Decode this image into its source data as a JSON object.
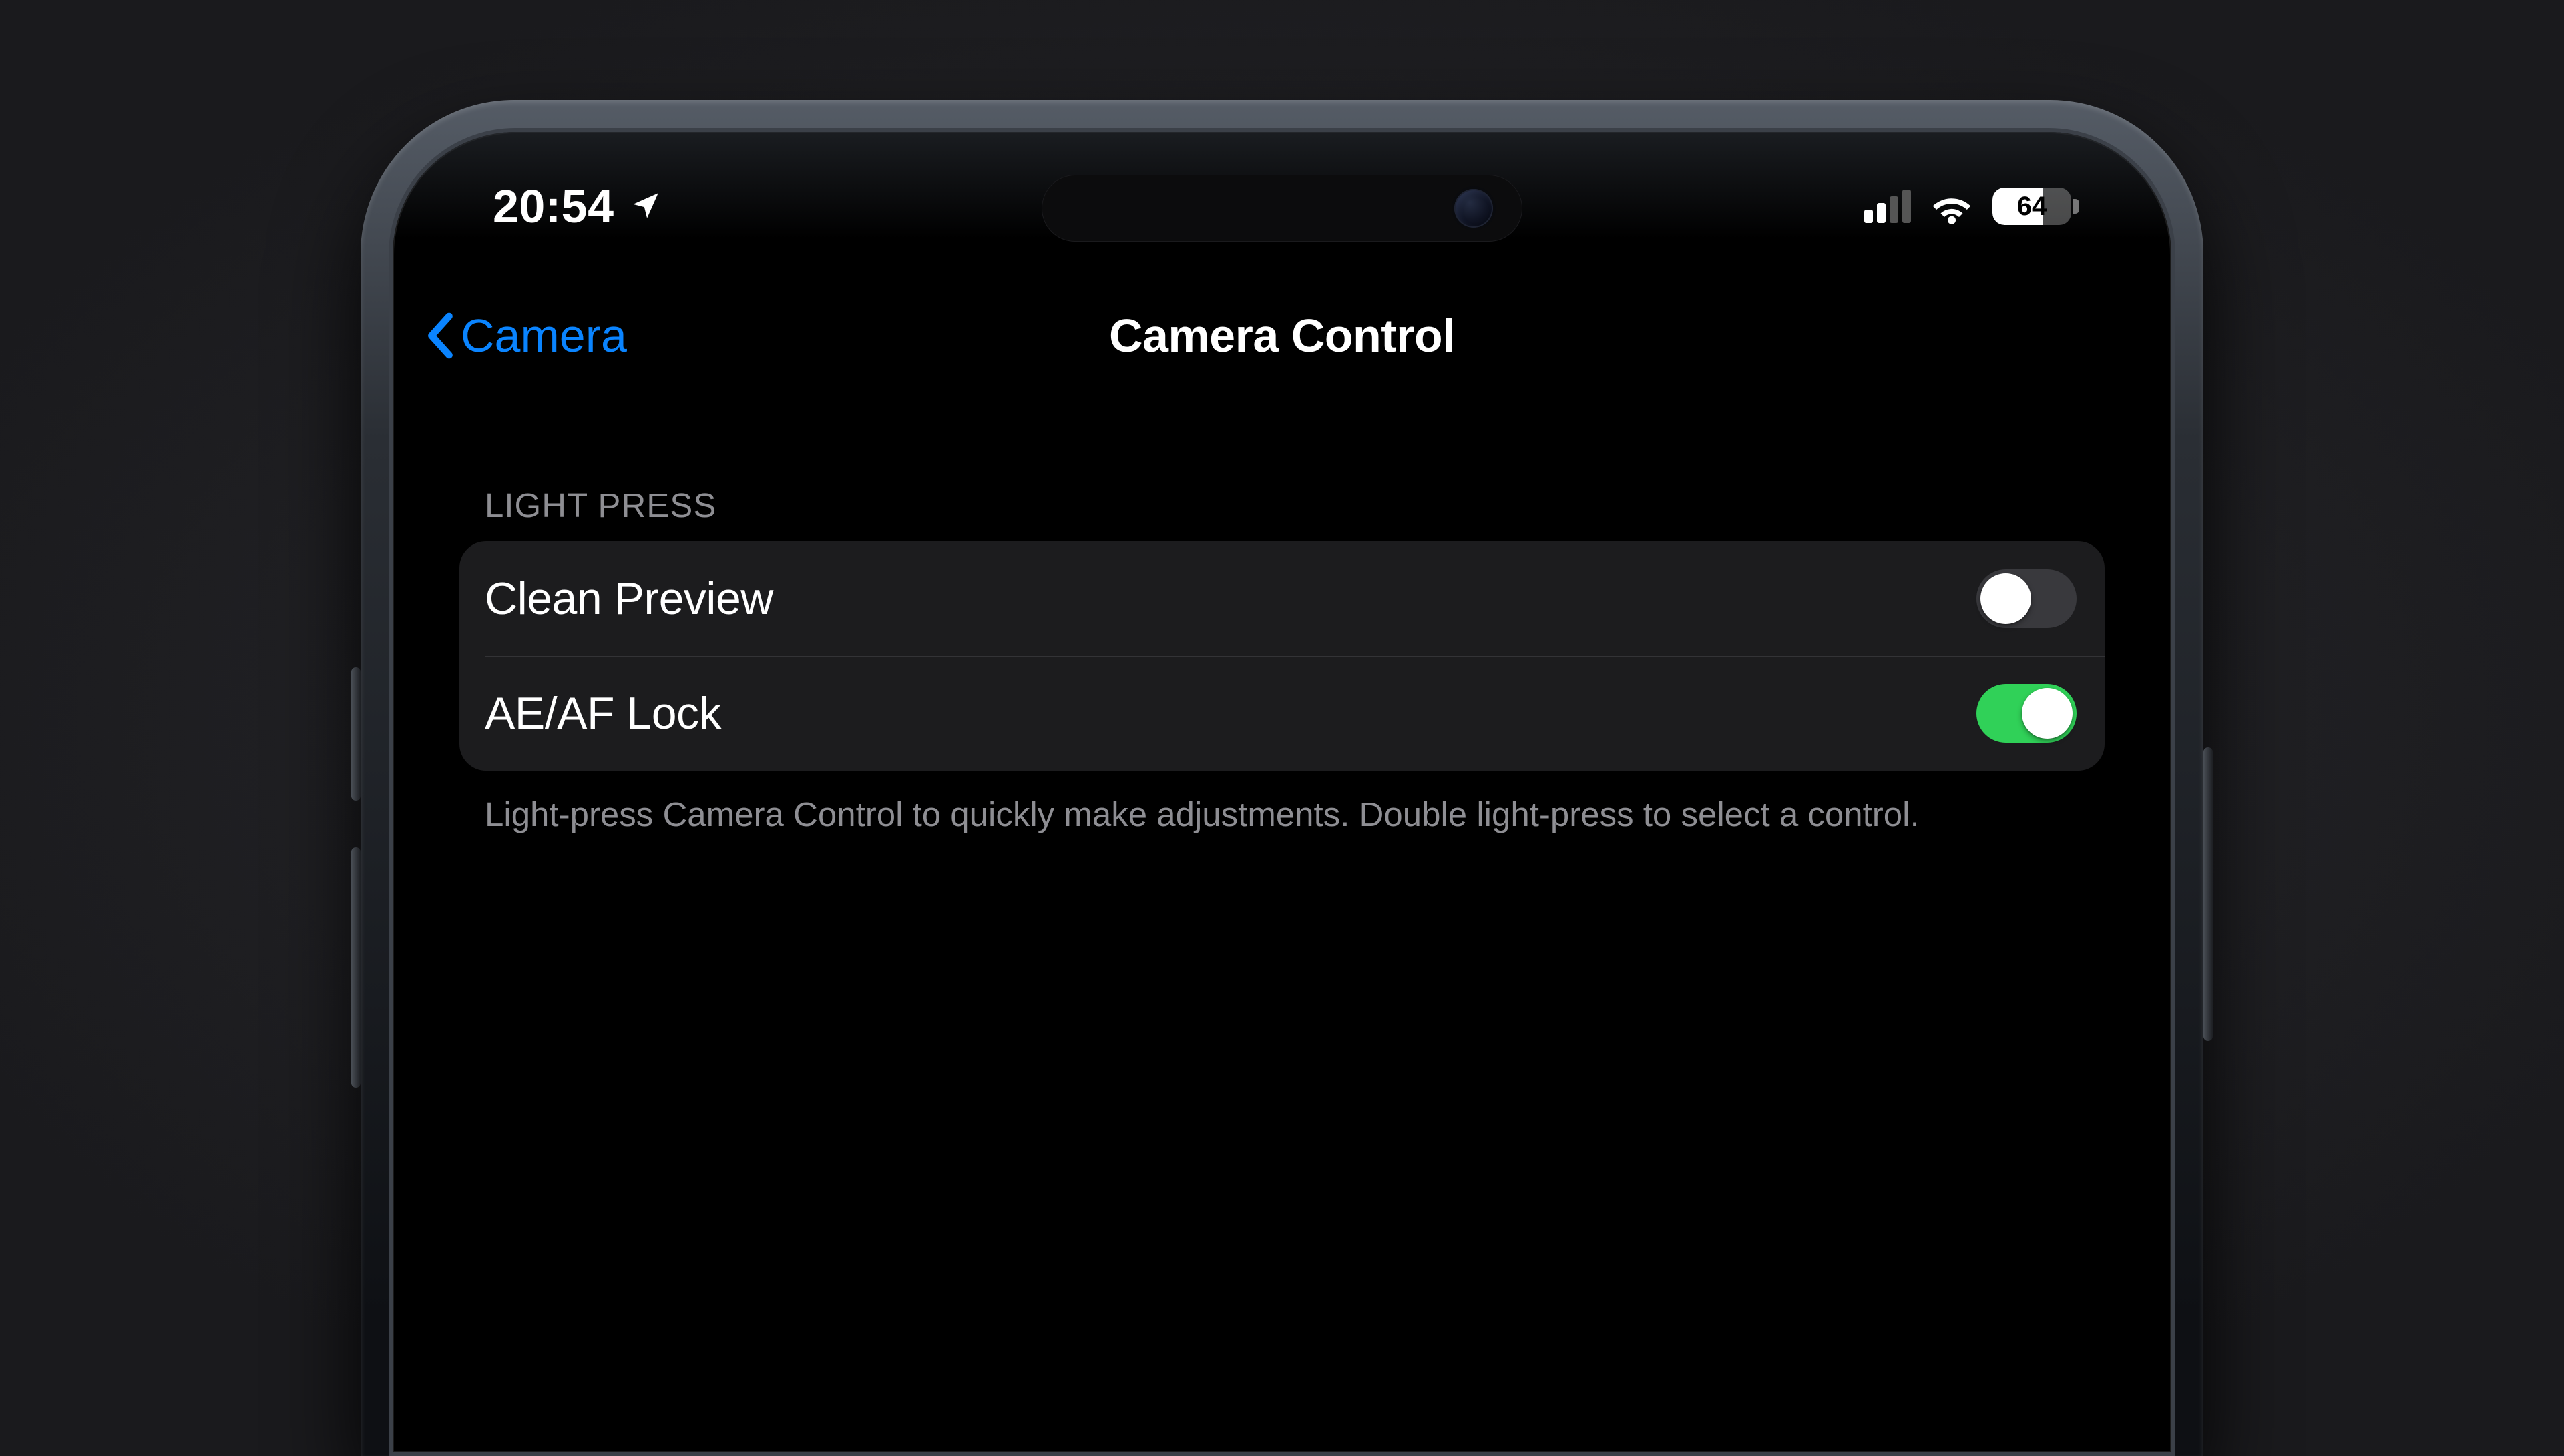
{
  "status": {
    "time": "20:54",
    "battery_percent": 64,
    "location_icon": "location-arrow-icon",
    "cellular_active_bars": 2,
    "cellular_total_bars": 4
  },
  "nav": {
    "back_label": "Camera",
    "title": "Camera Control"
  },
  "section": {
    "header": "LIGHT PRESS",
    "rows": {
      "clean_preview": {
        "label": "Clean Preview",
        "on": false
      },
      "aeaf_lock": {
        "label": "AE/AF Lock",
        "on": true
      }
    },
    "footer": "Light-press Camera Control to quickly make adjustments. Double light-press to select a control."
  },
  "colors": {
    "accent": "#0a84ff",
    "switch_on": "#30d158",
    "group_bg": "#1c1c1e",
    "text_secondary": "#8e8e93"
  }
}
